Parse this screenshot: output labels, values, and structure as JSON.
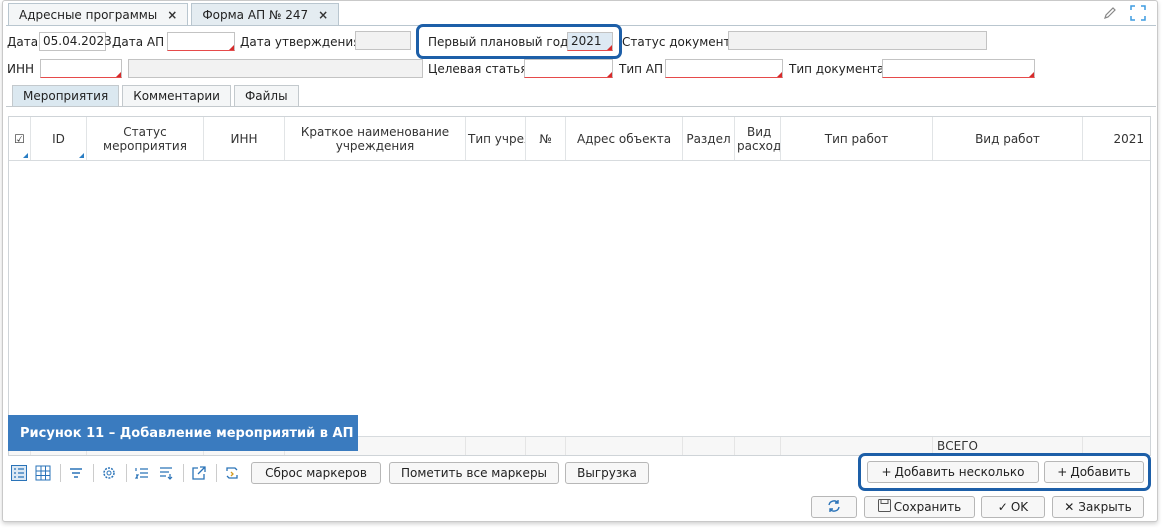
{
  "tabs": [
    {
      "label": "Адресные программы",
      "close": "×"
    },
    {
      "label": "Форма АП № 247",
      "close": "×"
    }
  ],
  "top_icons": [
    "pencil-icon",
    "fullscreen-icon"
  ],
  "form": {
    "date_label": "Дата",
    "date_value": "05.04.2023",
    "date_ap_label": "Дата АП",
    "date_ap_value": "",
    "approval_date_label": "Дата утверждения",
    "approval_date_value": "",
    "plan_year_label": "Первый плановый год",
    "plan_year_value": "2021",
    "doc_status_label": "Статус документа",
    "doc_status_value": "",
    "inn_label": "ИНН",
    "inn_value": "",
    "inn_name_value": "",
    "target_label": "Целевая статья",
    "target_value": "",
    "ap_type_label": "Тип АП",
    "ap_type_value": "",
    "doc_type_label": "Тип документа",
    "doc_type_value": ""
  },
  "subtabs": [
    "Мероприятия",
    "Комментарии",
    "Файлы"
  ],
  "grid": {
    "columns": [
      "☑",
      "ID",
      "Статус мероприятия",
      "ИНН",
      "Краткое наименование учреждения",
      "Тип учреждения",
      "№",
      "Адрес объекта",
      "Раздел",
      "Вид расход",
      "Тип работ",
      "Вид работ",
      "2021"
    ],
    "footer_total": "ВСЕГО"
  },
  "caption": "Рисунок 11 – Добавление мероприятий в АП",
  "toolbar": {
    "icons": [
      "list-icon",
      "table-icon",
      "filter-icon",
      "settings-icon",
      "numbered-list-icon",
      "sort-icon",
      "export-icon",
      "refresh-markers-icon"
    ],
    "reset_markers": "Сброс маркеров",
    "mark_all": "Пометить все маркеры",
    "export": "Выгрузка",
    "add_many": "Добавить несколько",
    "add": "Добавить"
  },
  "footer_buttons": {
    "refresh": "",
    "save": "Сохранить",
    "ok": "OK",
    "close": "Закрыть"
  },
  "colors": {
    "highlight": "#1d5fa8",
    "caption_bg": "#3a7bbf",
    "required": "#d62b2b"
  }
}
